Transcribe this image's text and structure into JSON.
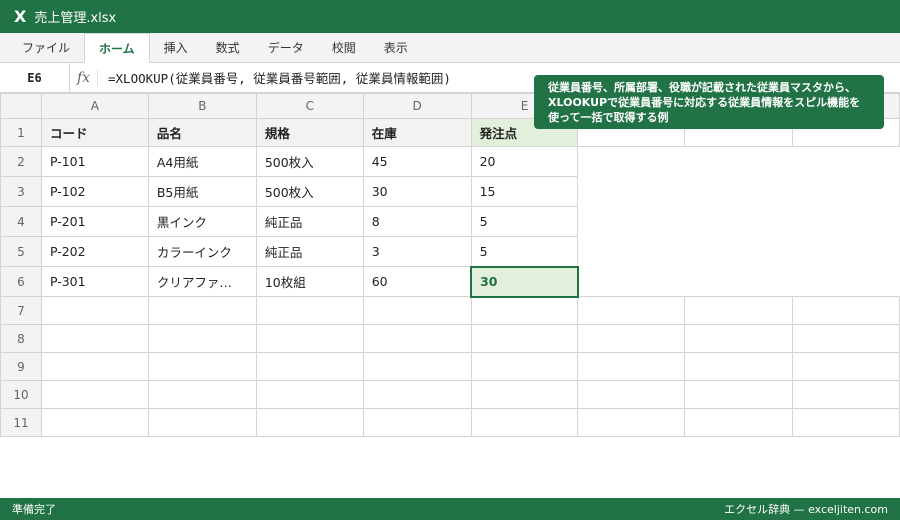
{
  "window": {
    "icon": "X",
    "title": "売上管理.xlsx"
  },
  "ribbon": {
    "tabs": [
      "ファイル",
      "ホーム",
      "挿入",
      "数式",
      "データ",
      "校閲",
      "表示"
    ],
    "active": 1
  },
  "formula_bar": {
    "cell_ref": "E6",
    "fx_label": "fx",
    "formula": "=XLOOKUP(従業員番号, 従業員番号範囲, 従業員情報範囲)"
  },
  "tooltip": {
    "text": "従業員番号、所属部署、役職が記載された従業員マスタから、XLOOKUPで従業員番号に対応する従業員情報をスピル機能を使って一括で取得する例"
  },
  "sheet": {
    "columns": [
      "A",
      "B",
      "C",
      "D",
      "E",
      "",
      "",
      ""
    ],
    "rows": [
      {
        "num": "1",
        "cells": [
          "コード",
          "品名",
          "規格",
          "在庫",
          "発注点"
        ]
      },
      {
        "num": "2",
        "cells": [
          "P-101",
          "A4用紙",
          "500枚入",
          "45",
          "20"
        ]
      },
      {
        "num": "3",
        "cells": [
          "P-102",
          "B5用紙",
          "500枚入",
          "30",
          "15"
        ]
      },
      {
        "num": "4",
        "cells": [
          "P-201",
          "黒インク",
          "純正品",
          "8",
          "5"
        ]
      },
      {
        "num": "5",
        "cells": [
          "P-202",
          "カラーインク",
          "純正品",
          "3",
          "5"
        ]
      },
      {
        "num": "6",
        "cells": [
          "P-301",
          "クリアファ…",
          "10枚組",
          "60",
          "30"
        ]
      },
      {
        "num": "7",
        "cells": []
      },
      {
        "num": "8",
        "cells": []
      },
      {
        "num": "9",
        "cells": []
      },
      {
        "num": "10",
        "cells": []
      },
      {
        "num": "11",
        "cells": []
      }
    ]
  },
  "status_bar": {
    "left": "準備完了",
    "right": "エクセル辞典 — exceljiten.com"
  },
  "colors": {
    "brand_green": "#217346",
    "highlight": "#e2efda"
  }
}
